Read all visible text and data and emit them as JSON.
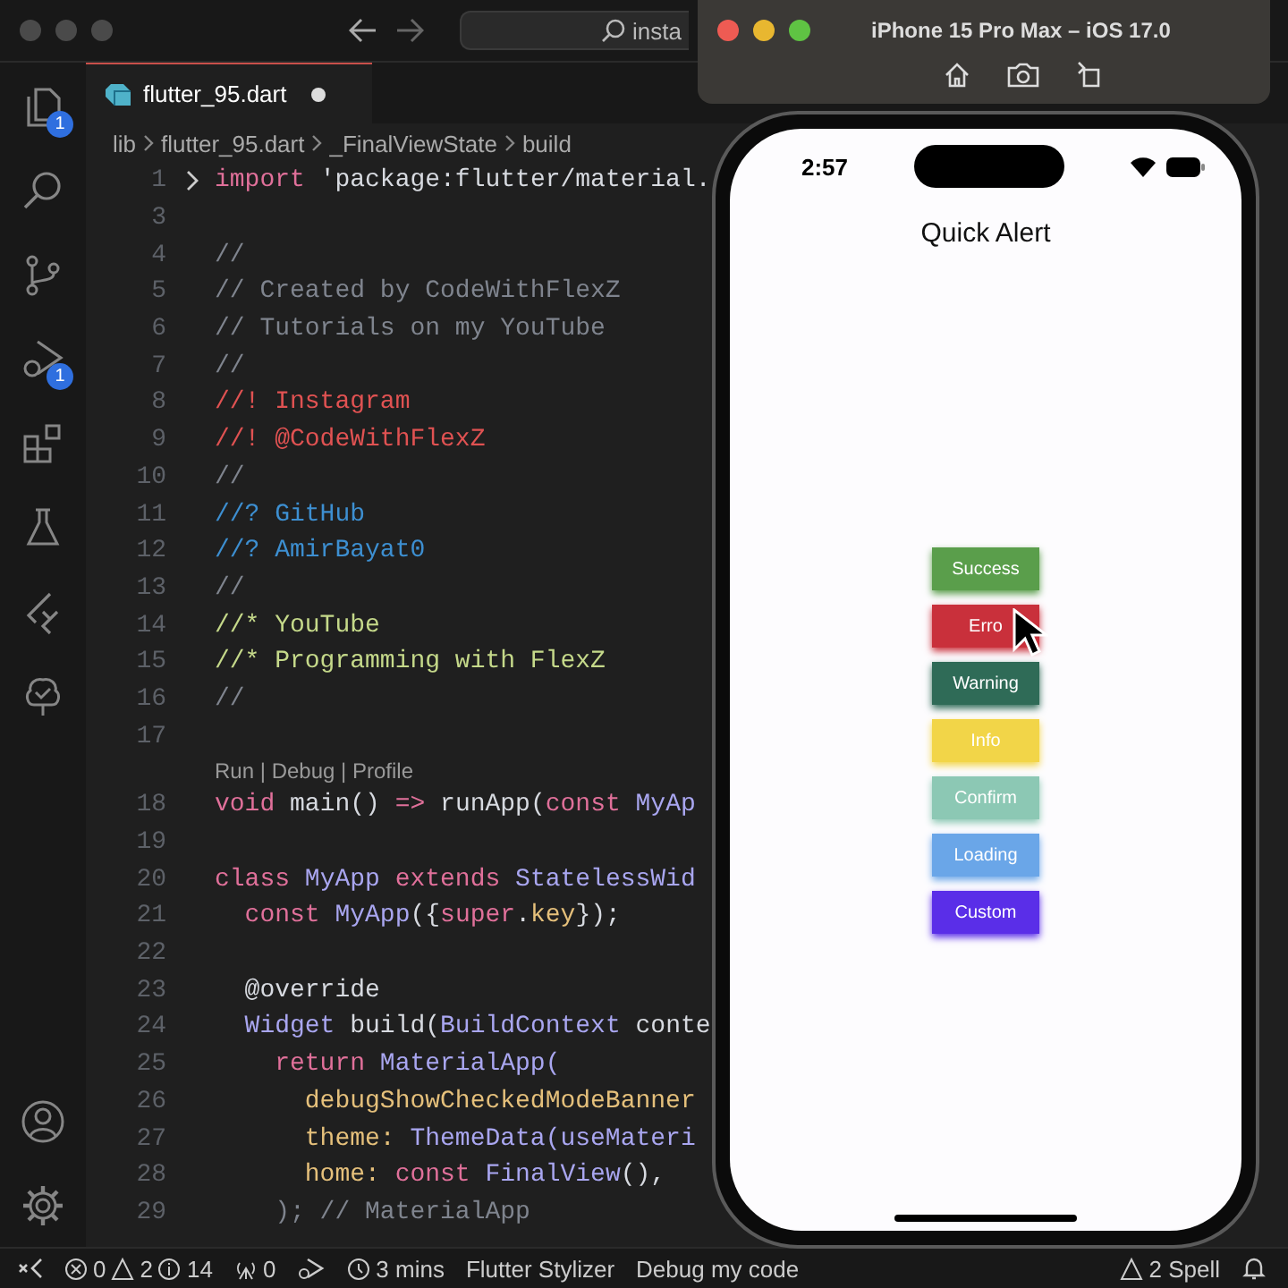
{
  "title_bar": {
    "search_text": "insta"
  },
  "activity_bar": {
    "explorer_badge": "1",
    "debug_badge": "1"
  },
  "tab": {
    "label": "flutter_95.dart",
    "modified": true
  },
  "breadcrumb": [
    "lib",
    "flutter_95.dart",
    "_FinalViewState",
    "build"
  ],
  "code_lines": [
    {
      "kind": "code",
      "number": "1",
      "folded": true,
      "tokens": [
        {
          "text": "import",
          "kind": "keyword"
        },
        {
          "text": " 'package:flutter/material.",
          "kind": "string"
        }
      ]
    },
    {
      "kind": "code",
      "number": "3",
      "folded": false
    },
    {
      "kind": "code",
      "number": "4",
      "folded": false,
      "tokens": [
        {
          "text": "//",
          "kind": "comment"
        }
      ]
    },
    {
      "kind": "code",
      "number": "5",
      "folded": false,
      "tokens": [
        {
          "text": "// Created by CodeWithFlexZ",
          "kind": "comment"
        }
      ]
    },
    {
      "kind": "code",
      "number": "6",
      "folded": false,
      "tokens": [
        {
          "text": "// Tutorials on my YouTube",
          "kind": "comment"
        }
      ]
    },
    {
      "kind": "code",
      "number": "7",
      "folded": false,
      "tokens": [
        {
          "text": "//",
          "kind": "comment"
        }
      ]
    },
    {
      "kind": "code",
      "number": "8",
      "folded": false,
      "tokens": [
        {
          "text": "//! Instagram",
          "kind": "alert"
        }
      ]
    },
    {
      "kind": "code",
      "number": "9",
      "folded": false,
      "tokens": [
        {
          "text": "//! @CodeWithFlexZ",
          "kind": "alert"
        }
      ]
    },
    {
      "kind": "code",
      "number": "10",
      "folded": false,
      "tokens": [
        {
          "text": "//",
          "kind": "comment"
        }
      ]
    },
    {
      "kind": "code",
      "number": "11",
      "folded": false,
      "tokens": [
        {
          "text": "//? GitHub",
          "kind": "query"
        }
      ]
    },
    {
      "kind": "code",
      "number": "12",
      "folded": false,
      "tokens": [
        {
          "text": "//? AmirBayat0",
          "kind": "query"
        }
      ]
    },
    {
      "kind": "code",
      "number": "13",
      "folded": false,
      "tokens": [
        {
          "text": "//",
          "kind": "comment"
        }
      ]
    },
    {
      "kind": "code",
      "number": "14",
      "folded": false,
      "tokens": [
        {
          "text": "//* YouTube",
          "kind": "highlight"
        }
      ]
    },
    {
      "kind": "code",
      "number": "15",
      "folded": false,
      "tokens": [
        {
          "text": "//* Programming with FlexZ",
          "kind": "highlight"
        }
      ]
    },
    {
      "kind": "code",
      "number": "16",
      "folded": false,
      "tokens": [
        {
          "text": "//",
          "kind": "comment"
        }
      ]
    },
    {
      "kind": "code",
      "number": "17",
      "folded": false
    },
    {
      "kind": "lens",
      "folded": false,
      "tokens": [
        {
          "text": "Run",
          "kind": "link"
        },
        {
          "text": " | ",
          "kind": "separator"
        },
        {
          "text": "Debug",
          "kind": "link"
        },
        {
          "text": " | ",
          "kind": "separator"
        },
        {
          "text": "Profile",
          "kind": "link"
        }
      ]
    },
    {
      "kind": "code",
      "number": "18",
      "folded": false,
      "tokens": [
        {
          "text": "void",
          "kind": "keyword"
        },
        {
          "text": " main() ",
          "kind": "plain"
        },
        {
          "text": "=>",
          "kind": "keyword"
        },
        {
          "text": " runApp(",
          "kind": "plain"
        },
        {
          "text": "const",
          "kind": "keyword"
        },
        {
          "text": " MyAp",
          "kind": "type"
        }
      ]
    },
    {
      "kind": "code",
      "number": "19",
      "folded": false
    },
    {
      "kind": "code",
      "number": "20",
      "folded": false,
      "tokens": [
        {
          "text": "class",
          "kind": "keyword"
        },
        {
          "text": " MyApp ",
          "kind": "type"
        },
        {
          "text": "extends",
          "kind": "keyword"
        },
        {
          "text": " StatelessWid",
          "kind": "type"
        }
      ]
    },
    {
      "kind": "code",
      "number": "21",
      "folded": false,
      "tokens": [
        {
          "text": "  const",
          "kind": "keyword"
        },
        {
          "text": " MyApp",
          "kind": "type"
        },
        {
          "text": "({",
          "kind": "plain"
        },
        {
          "text": "super",
          "kind": "keyword"
        },
        {
          "text": ".",
          "kind": "plain"
        },
        {
          "text": "key",
          "kind": "property"
        },
        {
          "text": "});",
          "kind": "plain"
        }
      ]
    },
    {
      "kind": "code",
      "number": "22",
      "folded": false
    },
    {
      "kind": "code",
      "number": "23",
      "folded": false,
      "tokens": [
        {
          "text": "  @override",
          "kind": "plain"
        }
      ]
    },
    {
      "kind": "code",
      "number": "24",
      "folded": false,
      "tokens": [
        {
          "text": "  Widget",
          "kind": "type"
        },
        {
          "text": " build(",
          "kind": "plain"
        },
        {
          "text": "BuildContext",
          "kind": "type"
        },
        {
          "text": " conte",
          "kind": "plain"
        }
      ]
    },
    {
      "kind": "code",
      "number": "25",
      "folded": false,
      "tokens": [
        {
          "text": "    return",
          "kind": "keyword"
        },
        {
          "text": " MaterialApp(",
          "kind": "type"
        }
      ]
    },
    {
      "kind": "code",
      "number": "26",
      "folded": false,
      "tokens": [
        {
          "text": "      debugShowCheckedModeBanner",
          "kind": "property"
        }
      ]
    },
    {
      "kind": "code",
      "number": "27",
      "folded": false,
      "tokens": [
        {
          "text": "      theme: ",
          "kind": "property"
        },
        {
          "text": "ThemeData(useMateri",
          "kind": "type"
        }
      ]
    },
    {
      "kind": "code",
      "number": "28",
      "folded": false,
      "tokens": [
        {
          "text": "      home: ",
          "kind": "property"
        },
        {
          "text": "const",
          "kind": "keyword"
        },
        {
          "text": " FinalView",
          "kind": "type"
        },
        {
          "text": "(),",
          "kind": "plain"
        }
      ]
    },
    {
      "kind": "code",
      "number": "29",
      "folded": false,
      "tokens": [
        {
          "text": "    ); // MaterialApp",
          "kind": "comment"
        }
      ]
    }
  ],
  "simulator": {
    "title": "iPhone 15 Pro Max – iOS 17.0"
  },
  "phone": {
    "time": "2:57",
    "app_title": "Quick Alert",
    "buttons": [
      {
        "label": "Success",
        "color": "#5a9e4b"
      },
      {
        "label": "Erro",
        "color": "#c9303b"
      },
      {
        "label": "Warning",
        "color": "#2f6b57"
      },
      {
        "label": "Info",
        "color": "#f2d548"
      },
      {
        "label": "Confirm",
        "color": "#8cc8b4"
      },
      {
        "label": "Loading",
        "color": "#6aa6e8"
      },
      {
        "label": "Custom",
        "color": "#5a2ee8"
      }
    ]
  },
  "status_bar": {
    "errors": "0",
    "warnings": "2",
    "infos": "14",
    "ports": "0",
    "timer": "3 mins",
    "items": [
      "Flutter Stylizer",
      "Debug my code"
    ],
    "spell": "2 Spell"
  }
}
